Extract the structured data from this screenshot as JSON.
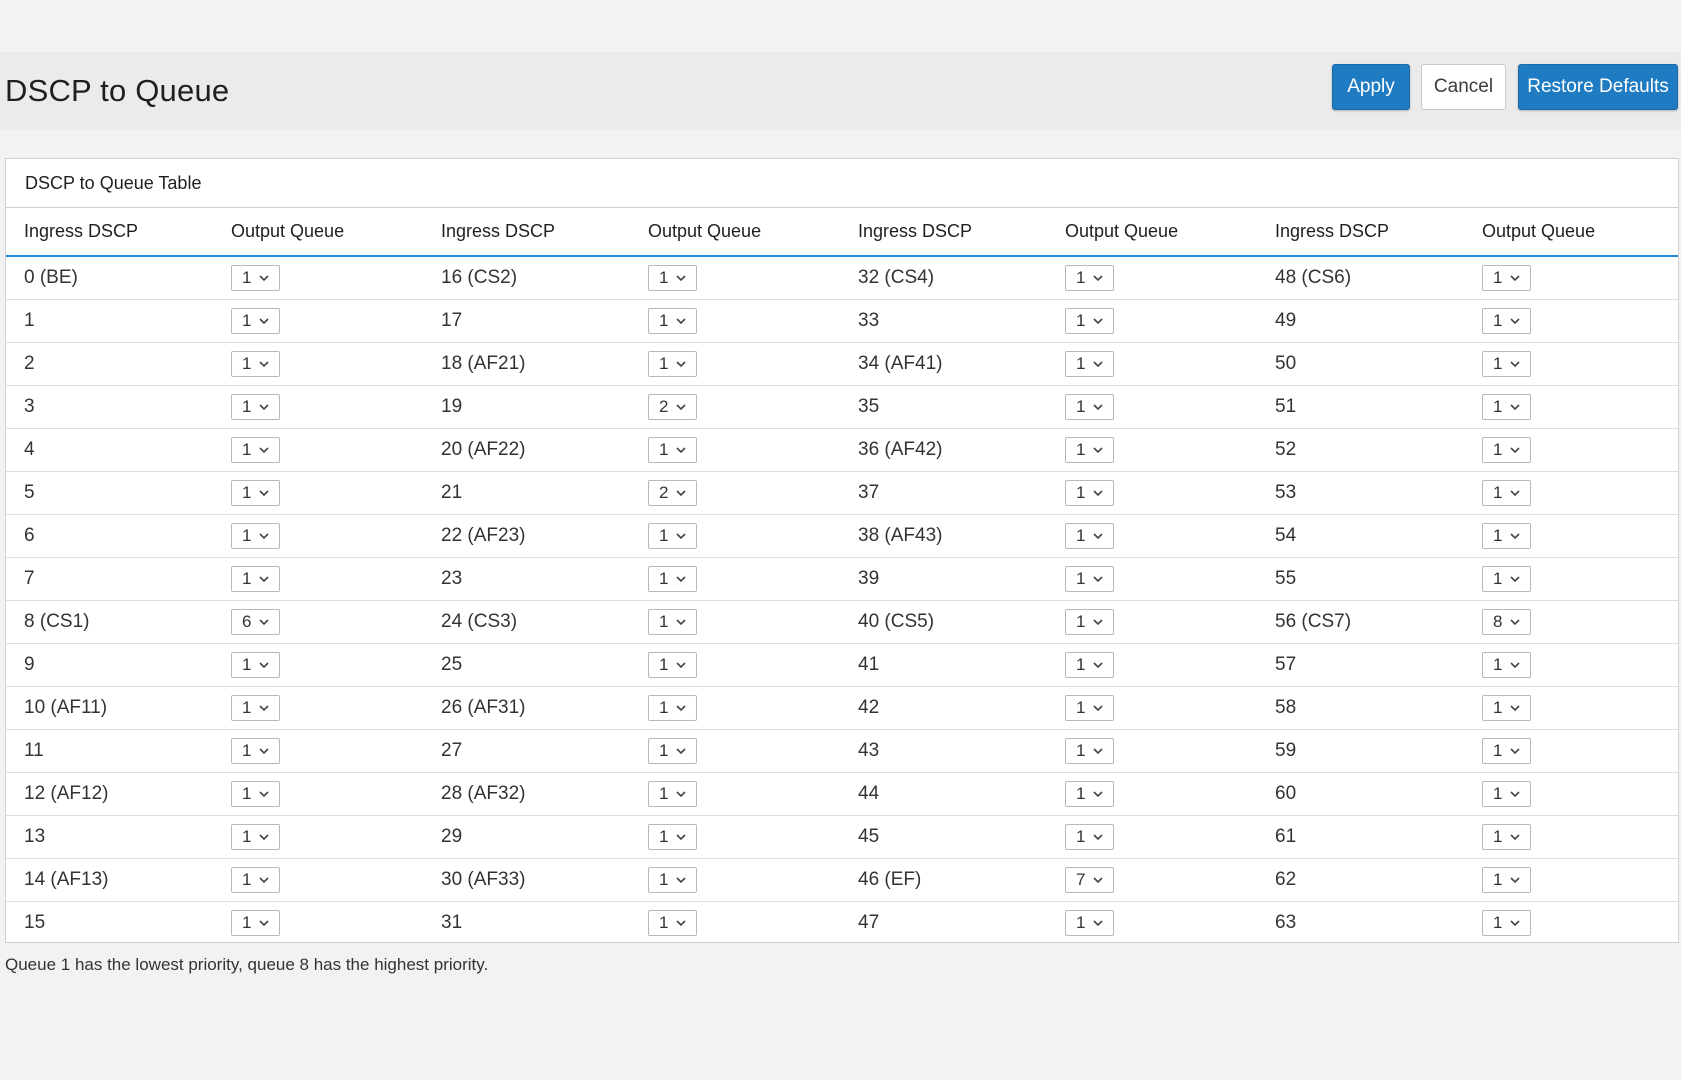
{
  "header": {
    "title": "DSCP to Queue",
    "apply_label": "Apply",
    "cancel_label": "Cancel",
    "restore_label": "Restore Defaults"
  },
  "table": {
    "title": "DSCP to Queue Table",
    "columns": [
      "Ingress DSCP",
      "Output Queue",
      "Ingress DSCP",
      "Output Queue",
      "Ingress DSCP",
      "Output Queue",
      "Ingress DSCP",
      "Output Queue"
    ],
    "rows": [
      [
        {
          "dscp": "0 (BE)",
          "queue": "1"
        },
        {
          "dscp": "16 (CS2)",
          "queue": "1"
        },
        {
          "dscp": "32 (CS4)",
          "queue": "1"
        },
        {
          "dscp": "48 (CS6)",
          "queue": "1"
        }
      ],
      [
        {
          "dscp": "1",
          "queue": "1"
        },
        {
          "dscp": "17",
          "queue": "1"
        },
        {
          "dscp": "33",
          "queue": "1"
        },
        {
          "dscp": "49",
          "queue": "1"
        }
      ],
      [
        {
          "dscp": "2",
          "queue": "1"
        },
        {
          "dscp": "18 (AF21)",
          "queue": "1"
        },
        {
          "dscp": "34 (AF41)",
          "queue": "1"
        },
        {
          "dscp": "50",
          "queue": "1"
        }
      ],
      [
        {
          "dscp": "3",
          "queue": "1"
        },
        {
          "dscp": "19",
          "queue": "2"
        },
        {
          "dscp": "35",
          "queue": "1"
        },
        {
          "dscp": "51",
          "queue": "1"
        }
      ],
      [
        {
          "dscp": "4",
          "queue": "1"
        },
        {
          "dscp": "20 (AF22)",
          "queue": "1"
        },
        {
          "dscp": "36 (AF42)",
          "queue": "1"
        },
        {
          "dscp": "52",
          "queue": "1"
        }
      ],
      [
        {
          "dscp": "5",
          "queue": "1"
        },
        {
          "dscp": "21",
          "queue": "2"
        },
        {
          "dscp": "37",
          "queue": "1"
        },
        {
          "dscp": "53",
          "queue": "1"
        }
      ],
      [
        {
          "dscp": "6",
          "queue": "1"
        },
        {
          "dscp": "22 (AF23)",
          "queue": "1"
        },
        {
          "dscp": "38 (AF43)",
          "queue": "1"
        },
        {
          "dscp": "54",
          "queue": "1"
        }
      ],
      [
        {
          "dscp": "7",
          "queue": "1"
        },
        {
          "dscp": "23",
          "queue": "1"
        },
        {
          "dscp": "39",
          "queue": "1"
        },
        {
          "dscp": "55",
          "queue": "1"
        }
      ],
      [
        {
          "dscp": "8 (CS1)",
          "queue": "6"
        },
        {
          "dscp": "24 (CS3)",
          "queue": "1"
        },
        {
          "dscp": "40 (CS5)",
          "queue": "1"
        },
        {
          "dscp": "56 (CS7)",
          "queue": "8"
        }
      ],
      [
        {
          "dscp": "9",
          "queue": "1"
        },
        {
          "dscp": "25",
          "queue": "1"
        },
        {
          "dscp": "41",
          "queue": "1"
        },
        {
          "dscp": "57",
          "queue": "1"
        }
      ],
      [
        {
          "dscp": "10 (AF11)",
          "queue": "1"
        },
        {
          "dscp": "26 (AF31)",
          "queue": "1"
        },
        {
          "dscp": "42",
          "queue": "1"
        },
        {
          "dscp": "58",
          "queue": "1"
        }
      ],
      [
        {
          "dscp": "11",
          "queue": "1"
        },
        {
          "dscp": "27",
          "queue": "1"
        },
        {
          "dscp": "43",
          "queue": "1"
        },
        {
          "dscp": "59",
          "queue": "1"
        }
      ],
      [
        {
          "dscp": "12 (AF12)",
          "queue": "1"
        },
        {
          "dscp": "28 (AF32)",
          "queue": "1"
        },
        {
          "dscp": "44",
          "queue": "1"
        },
        {
          "dscp": "60",
          "queue": "1"
        }
      ],
      [
        {
          "dscp": "13",
          "queue": "1"
        },
        {
          "dscp": "29",
          "queue": "1"
        },
        {
          "dscp": "45",
          "queue": "1"
        },
        {
          "dscp": "61",
          "queue": "1"
        }
      ],
      [
        {
          "dscp": "14 (AF13)",
          "queue": "1"
        },
        {
          "dscp": "30 (AF33)",
          "queue": "1"
        },
        {
          "dscp": "46 (EF)",
          "queue": "7"
        },
        {
          "dscp": "62",
          "queue": "1"
        }
      ],
      [
        {
          "dscp": "15",
          "queue": "1"
        },
        {
          "dscp": "31",
          "queue": "1"
        },
        {
          "dscp": "47",
          "queue": "1"
        },
        {
          "dscp": "63",
          "queue": "1"
        }
      ]
    ]
  },
  "footnote": "Queue 1 has the lowest priority, queue 8 has the highest priority.",
  "colors": {
    "primary_button": "#1f7bc2",
    "header_rule": "#1f8ad6",
    "page_background": "#f2f2f2"
  },
  "icons": {
    "select_chevron": "chevron-down-icon"
  }
}
